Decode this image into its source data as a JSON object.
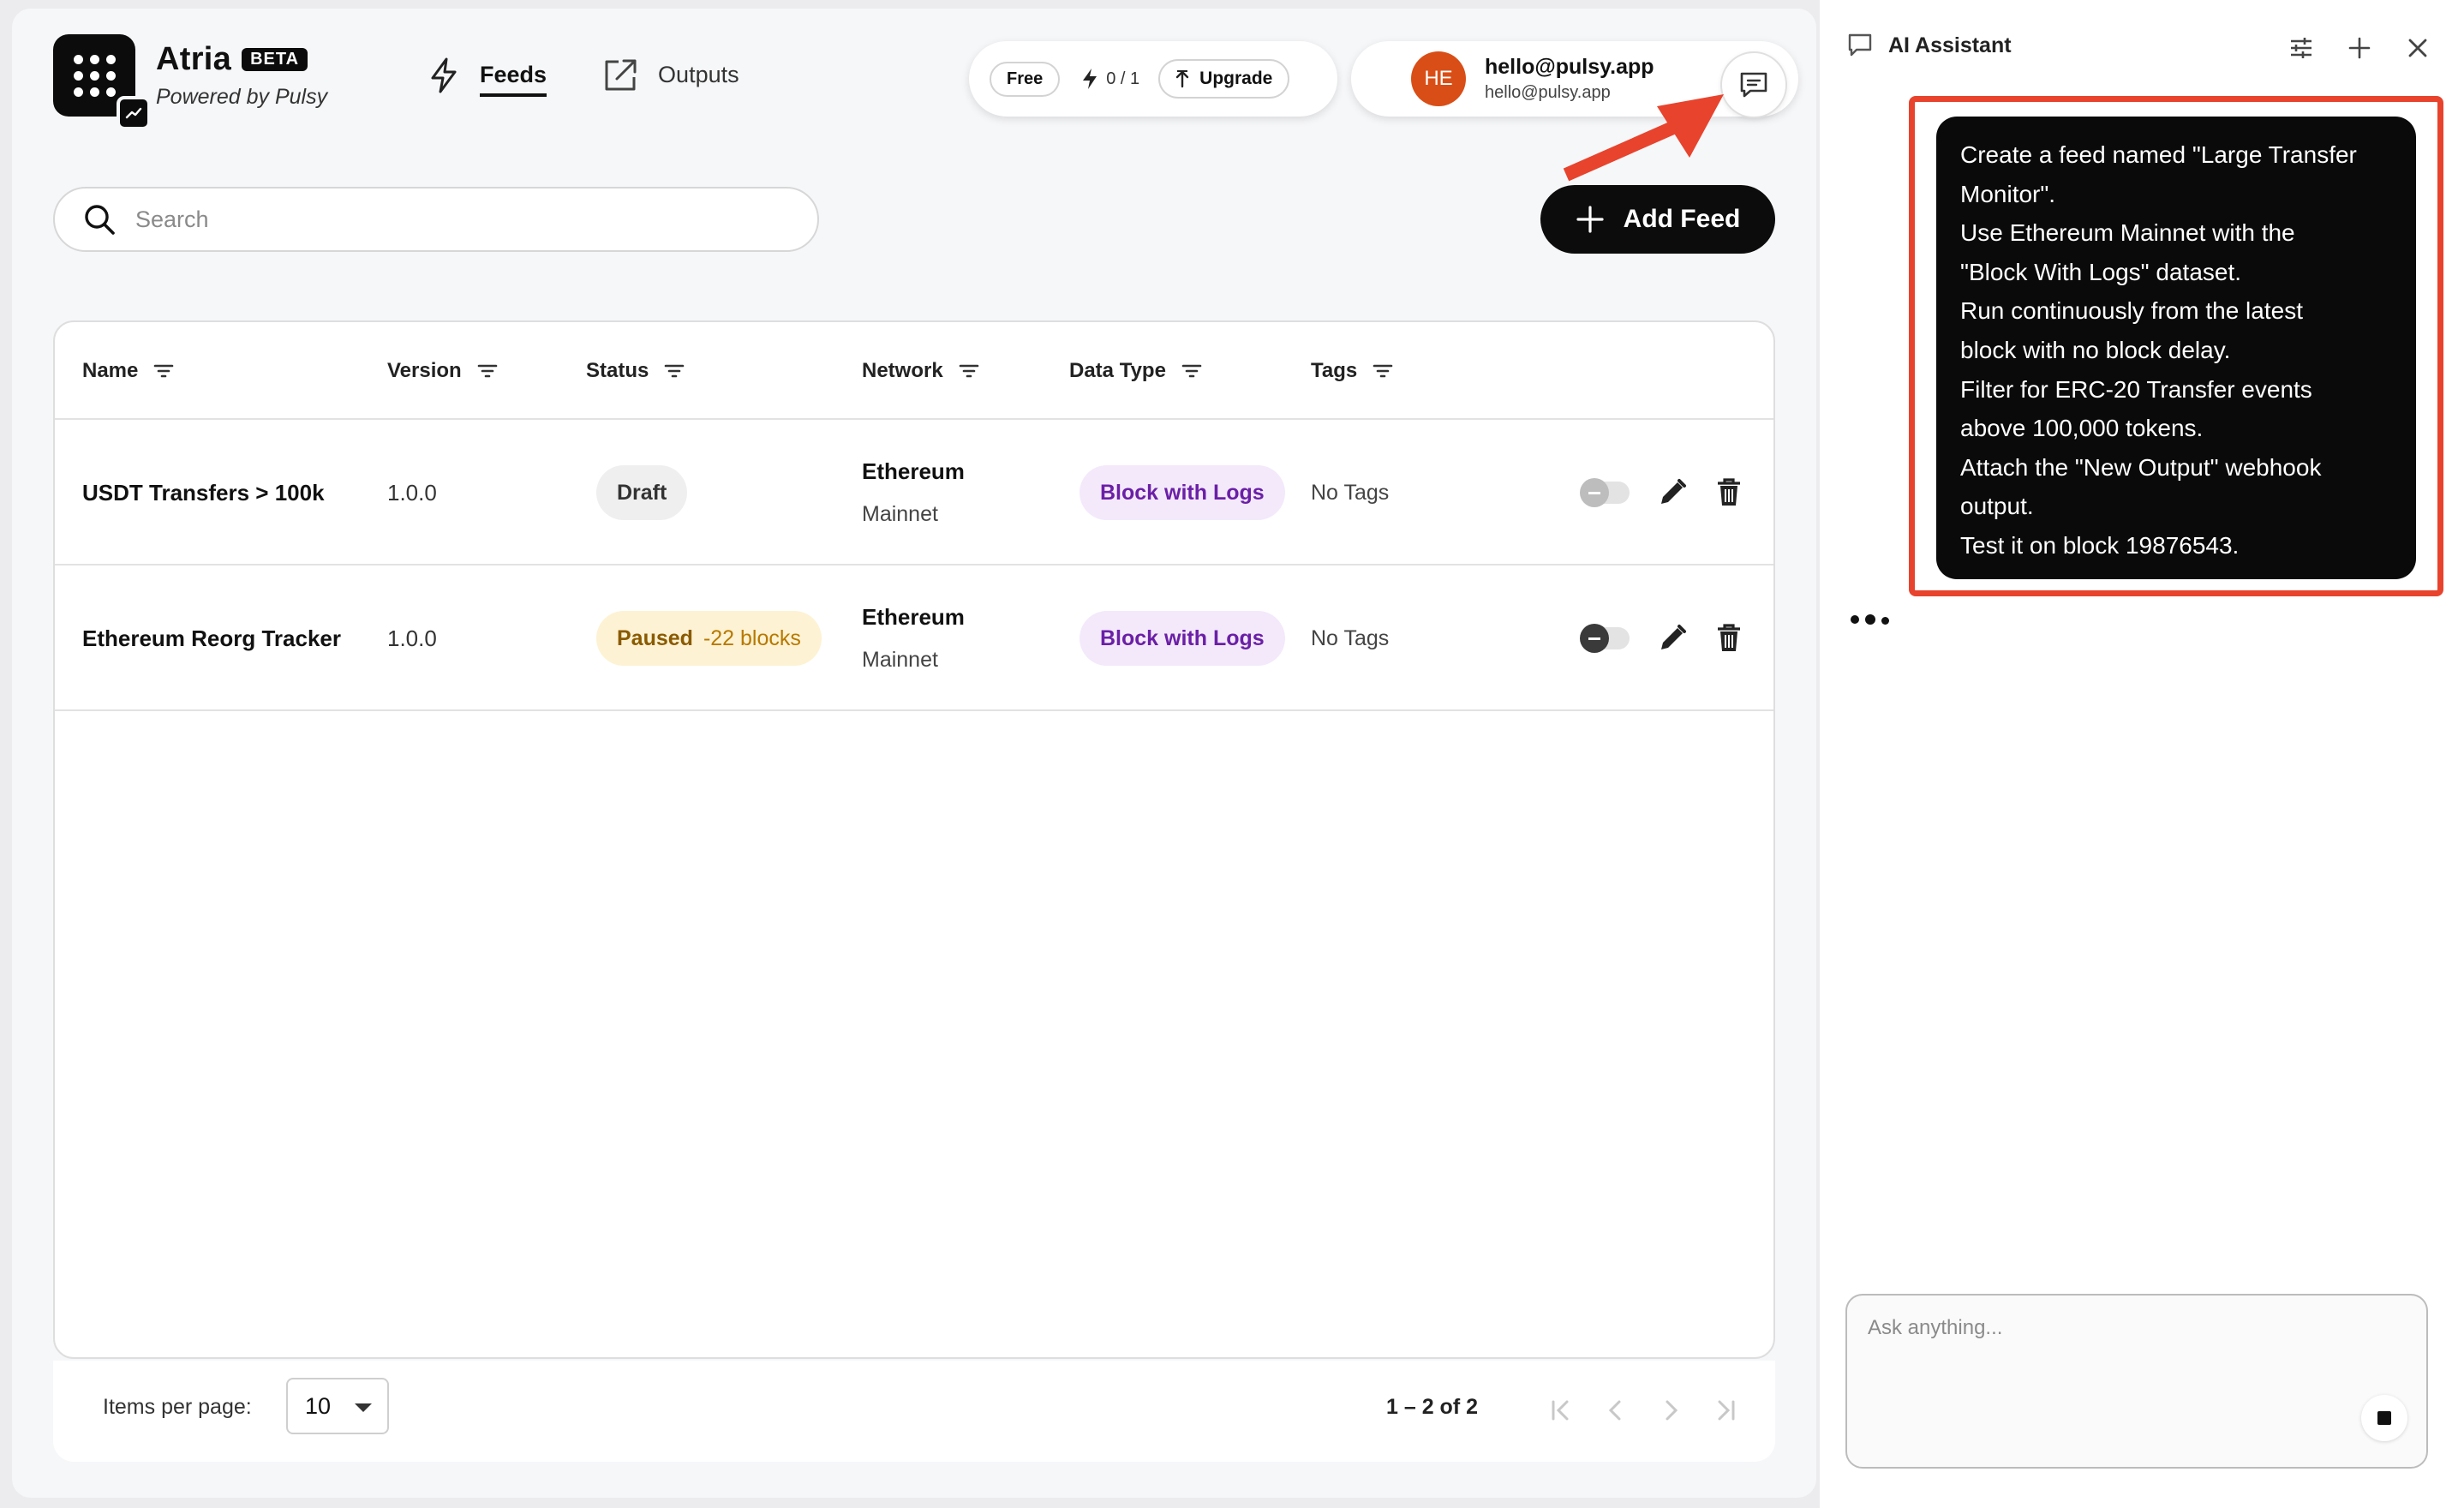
{
  "app": {
    "name": "Atria",
    "badge": "BETA",
    "subtitle": "Powered by Pulsy"
  },
  "nav": {
    "feeds_label": "Feeds",
    "outputs_label": "Outputs",
    "active": "Feeds"
  },
  "plan": {
    "tier": "Free",
    "usage": "0 / 1",
    "upgrade_label": "Upgrade"
  },
  "user": {
    "initials": "HE",
    "name": "hello@pulsy.app",
    "email": "hello@pulsy.app"
  },
  "search": {
    "placeholder": "Search",
    "value": ""
  },
  "add_feed_label": "Add Feed",
  "table": {
    "columns": [
      "Name",
      "Version",
      "Status",
      "Network",
      "Data Type",
      "Tags"
    ],
    "rows": [
      {
        "name": "USDT Transfers > 100k",
        "version": "1.0.0",
        "status": "Draft",
        "status_detail": "",
        "network_line1": "Ethereum",
        "network_line2": "Mainnet",
        "data_type": "Block with Logs",
        "tags": "No Tags",
        "toggle_on": false
      },
      {
        "name": "Ethereum Reorg Tracker",
        "version": "1.0.0",
        "status": "Paused",
        "status_detail": "-22 blocks",
        "network_line1": "Ethereum",
        "network_line2": "Mainnet",
        "data_type": "Block with Logs",
        "tags": "No Tags",
        "toggle_on": false
      }
    ]
  },
  "pagination": {
    "items_per_page_label": "Items per page:",
    "items_per_page": "10",
    "range": "1 – 2 of 2"
  },
  "assistant": {
    "title": "AI Assistant",
    "message_lines": [
      "Create a feed named \"Large Transfer",
      "Monitor\".",
      "Use Ethereum Mainnet with the",
      "\"Block With Logs\" dataset.",
      "Run continuously from the latest",
      "block with no block delay.",
      "Filter for ERC-20 Transfer events",
      "above 100,000 tokens.",
      "Attach the \"New Output\" webhook",
      "output.",
      "Test it on block 19876543."
    ],
    "input_placeholder": "Ask anything...",
    "input_value": ""
  },
  "colors": {
    "brand_dark": "#0c0c0c",
    "avatar": "#d94e16",
    "annotation_red": "#e8432d",
    "data_type_bg": "#f3e9fb",
    "data_type_text": "#6b1fa6",
    "paused_bg": "#fdf2d3",
    "paused_text": "#8a5a00"
  },
  "icons": {
    "nav_feeds": "lightning-icon",
    "nav_outputs": "external-link-icon",
    "search": "search-icon",
    "add": "plus-icon",
    "filter": "filter-lines-icon",
    "edit": "pencil-icon",
    "delete": "trash-icon",
    "chat": "chat-bubble-icon",
    "settings": "sliders-icon",
    "close": "close-icon"
  }
}
